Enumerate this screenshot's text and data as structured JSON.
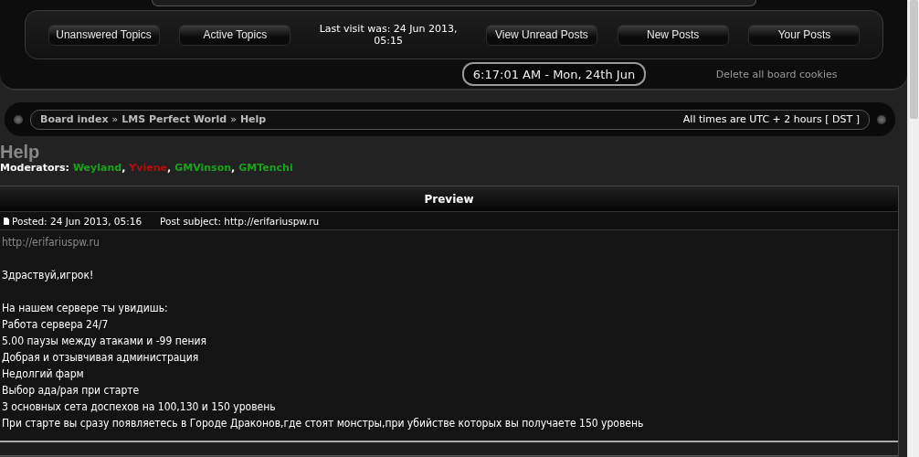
{
  "nav_buttons": [
    "Unanswered Topics",
    "Active Topics",
    "View Unread Posts",
    "New Posts",
    "Your Posts"
  ],
  "last_visit": "Last visit was: 24 Jun 2013, 05:15",
  "clock": "6:17:01 AM - Mon, 24th Jun",
  "delete_cookies": "Delete all board cookies",
  "breadcrumbs": [
    "Board index",
    "LMS Perfect World",
    "Help"
  ],
  "breadcrumb_separator": "»",
  "timezone": "All times are UTC + 2 hours [ DST ]",
  "forum_title": "Help",
  "moderators_label": "Moderators:",
  "moderator_separator": ",",
  "moderators": [
    {
      "name": "Weyland",
      "color": "#1aa31a"
    },
    {
      "name": "Yviene",
      "color": "#b30d0d"
    },
    {
      "name": "GMVinson",
      "color": "#1aa31a"
    },
    {
      "name": "GMTenchi",
      "color": "#1aa31a"
    }
  ],
  "preview": {
    "title": "Preview",
    "posted": "Posted: 24 Jun 2013, 05:16",
    "subject": "Post subject: http://erifariuspw.ru",
    "link": "http://erifariuspw.ru",
    "paragraphs": [
      [
        "Здраствуй,игрок!"
      ],
      [
        "На нашем сервере ты увидишь:",
        "Работа сервера 24/7",
        "5.00 паузы между атаками и -99 пения",
        "Добрая и отзывчивая администрация",
        "Недолгий фарм",
        "Выбор ада/рая при старте",
        "3 основных сета доспехов на 100,130 и 150 уровень",
        "При старте вы сразу появляетесь в Городе Драконов,где стоят монстры,при убийстве которых вы получаете 150 уровень"
      ]
    ]
  }
}
